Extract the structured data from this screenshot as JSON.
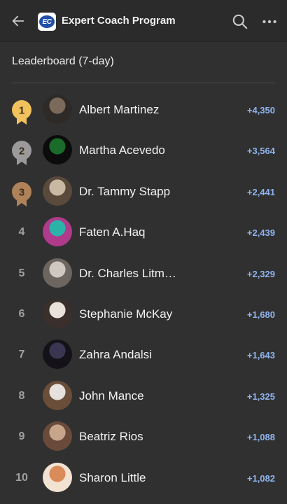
{
  "header": {
    "title": "Expert Coach Program",
    "logo_text": "EC",
    "back_icon": "arrow-left-icon",
    "search_icon": "search-icon",
    "more_icon": "more-horizontal-icon"
  },
  "leaderboard": {
    "title": "Leaderboard (7-day)",
    "entries": [
      {
        "rank": "1",
        "name": "Albert Martinez",
        "points": "+4,350",
        "badge_color": "#f1c15d"
      },
      {
        "rank": "2",
        "name": "Martha Acevedo",
        "points": "+3,564",
        "badge_color": "#9a9a9a"
      },
      {
        "rank": "3",
        "name": "Dr. Tammy Stapp",
        "points": "+2,441",
        "badge_color": "#b0825a"
      },
      {
        "rank": "4",
        "name": "Faten A.Haq",
        "points": "+2,439"
      },
      {
        "rank": "5",
        "name": "Dr. Charles Litm…",
        "points": "+2,329"
      },
      {
        "rank": "6",
        "name": "Stephanie McKay",
        "points": "+1,680"
      },
      {
        "rank": "7",
        "name": "Zahra Andalsi",
        "points": "+1,643"
      },
      {
        "rank": "8",
        "name": "John Mance",
        "points": "+1,325"
      },
      {
        "rank": "9",
        "name": "Beatriz Rios",
        "points": "+1,088"
      },
      {
        "rank": "10",
        "name": "Sharon Little",
        "points": "+1,082"
      }
    ]
  },
  "colors": {
    "background": "#303030",
    "appbar": "#2b2b2b",
    "points": "#8fb4ee",
    "gold": "#f1c15d",
    "silver": "#9a9a9a",
    "bronze": "#b0825a"
  }
}
